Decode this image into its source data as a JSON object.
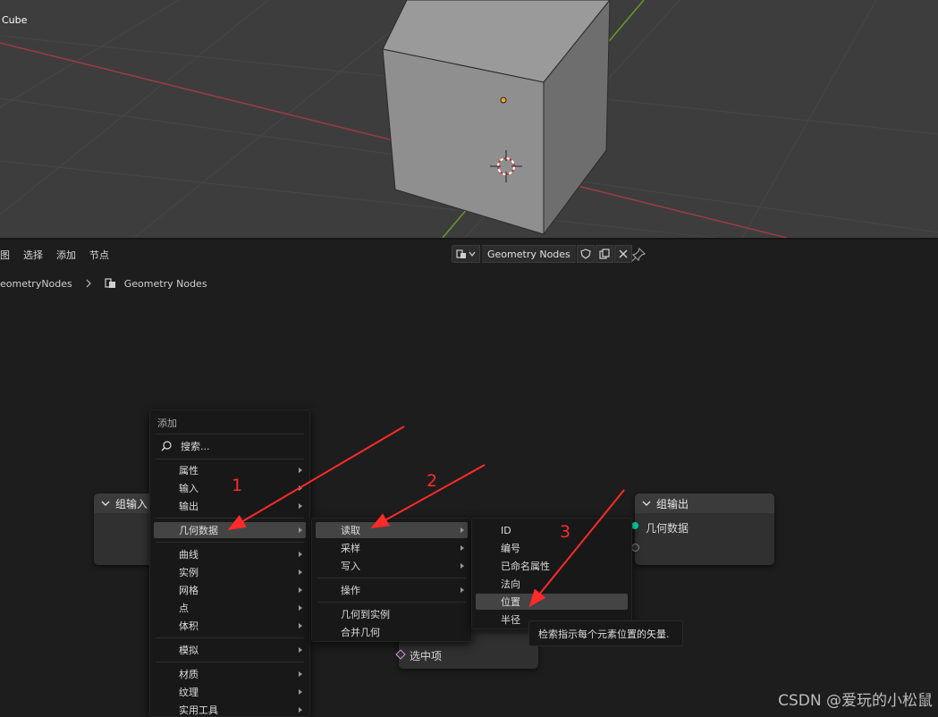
{
  "viewport": {
    "object_label": "Cube"
  },
  "header": {
    "menus": [
      "图",
      "选择",
      "添加",
      "节点"
    ],
    "tree_name": "Geometry Nodes"
  },
  "breadcrumb": {
    "parent": "eometryNodes",
    "current": "Geometry Nodes"
  },
  "nodes": {
    "group_input": {
      "title": "组输入"
    },
    "group_output": {
      "title": "组输出",
      "socket": "几何数据"
    },
    "selection": {
      "label": "选中项"
    }
  },
  "add_menu": {
    "title": "添加",
    "search": "搜索...",
    "items": [
      "属性",
      "输入",
      "输出",
      "几何数据",
      "曲线",
      "实例",
      "网格",
      "点",
      "体积",
      "模拟",
      "材质",
      "纹理",
      "实用工具"
    ]
  },
  "geometry_menu": {
    "items": [
      "读取",
      "采样",
      "写入",
      "操作",
      "几何到实例",
      "合并几何"
    ]
  },
  "read_menu": {
    "items": [
      "ID",
      "编号",
      "已命名属性",
      "法向",
      "位置",
      "半径"
    ]
  },
  "tooltip": "检索指示每个元素位置的矢量.",
  "annotations": [
    "1",
    "2",
    "3"
  ],
  "watermark": "CSDN @爱玩的小松鼠",
  "colors": {
    "accent_socket": "#00d6a3",
    "annotation_red": "#ff2a2a",
    "x_axis": "#9c3b45",
    "y_axis": "#6a9a2a"
  }
}
